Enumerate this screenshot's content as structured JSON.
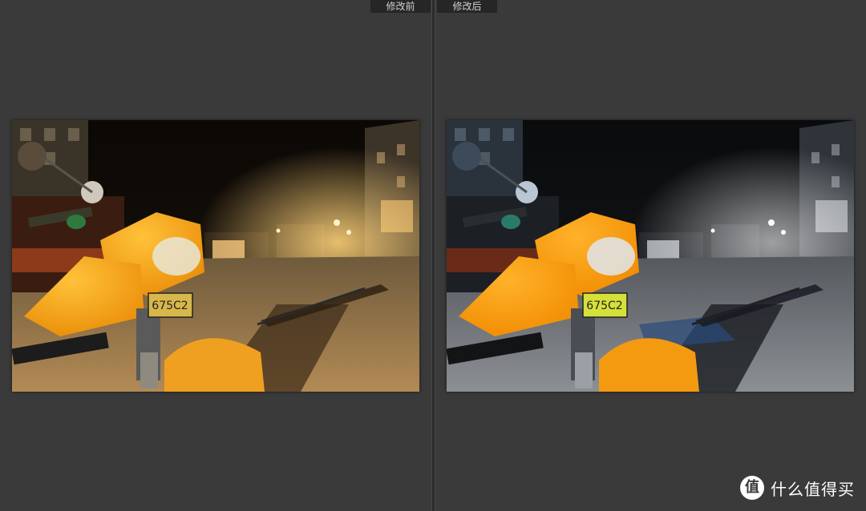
{
  "labels": {
    "before": "修改前",
    "after": "修改后"
  },
  "photos": {
    "before": {
      "tone": "warm",
      "plate": "675C2"
    },
    "after": {
      "tone": "cool",
      "plate": "675C2"
    }
  },
  "watermark": {
    "logo_glyph": "值",
    "text": "什么值得买"
  },
  "colors": {
    "background": "#3a3a3a",
    "label_bg": "#262626",
    "label_text": "#cfcfcf",
    "bike_orange": "#f5a10f",
    "warm_street": "#a8804a",
    "cool_street": "#6a6e72"
  }
}
